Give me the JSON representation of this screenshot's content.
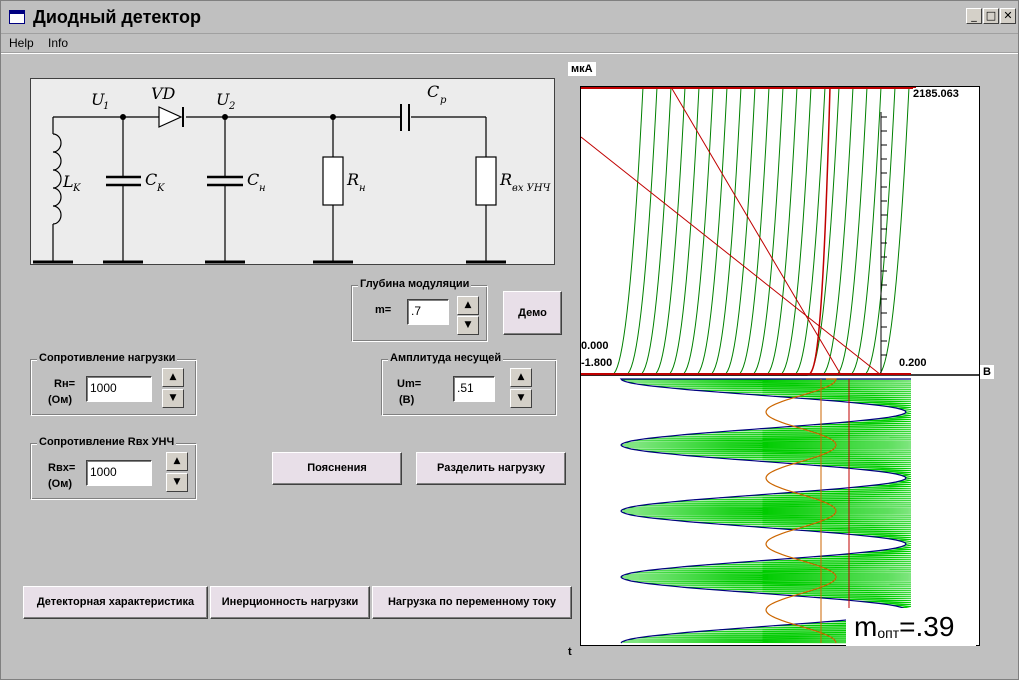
{
  "window": {
    "title": "Диодный детектор",
    "controls": [
      "_",
      "□",
      "✕"
    ]
  },
  "menu": [
    "Help",
    "Info"
  ],
  "circuit": {
    "labels": {
      "u1": "U",
      "u1_sub": "1",
      "vd": "VD",
      "u2": "U",
      "u2_sub": "2",
      "cp": "C",
      "cp_sub": "p",
      "lk": "L",
      "lk_sub": "K",
      "ck": "C",
      "ck_sub": "K",
      "cn": "C",
      "cn_sub": "н",
      "rn": "R",
      "rn_sub": "н",
      "rvx": "R",
      "rvx_sub": "вх УНЧ"
    }
  },
  "modulation": {
    "title": "Глубина модуляции",
    "label": "m=",
    "value": ".7"
  },
  "demo_button": "Демо",
  "load": {
    "title": "Сопротивление нагрузки",
    "label1": "Rн=",
    "label2": "(Ом)",
    "value": "1000"
  },
  "carrier": {
    "title": "Амплитуда несущей",
    "label1": "Um=",
    "label2": "(В)",
    "value": ".51"
  },
  "input_res": {
    "title": "Сопротивление Rвх УНЧ",
    "label1": "Rвх=",
    "label2": "(Ом)",
    "value": "1000"
  },
  "buttons": {
    "explain": "Пояснения",
    "split_load": "Разделить нагрузку",
    "detector_char": "Детекторная характеристика",
    "inertia": "Инерционность нагрузки",
    "ac_load": "Нагрузка по переменному току"
  },
  "plot": {
    "y_unit": "мкА",
    "x_unit": "В",
    "t_label": "t",
    "y_max": "2185.063",
    "y_min": "0.000",
    "x_min": "-1.800",
    "x_max": "0.200",
    "m_opt_prefix": "m",
    "m_opt_sub": "опт",
    "m_opt_value": "=.39"
  },
  "colors": {
    "green": "#008000",
    "red": "#c00000",
    "navy": "#000080",
    "light_green": "#00cc00",
    "orange": "#cc6600"
  }
}
